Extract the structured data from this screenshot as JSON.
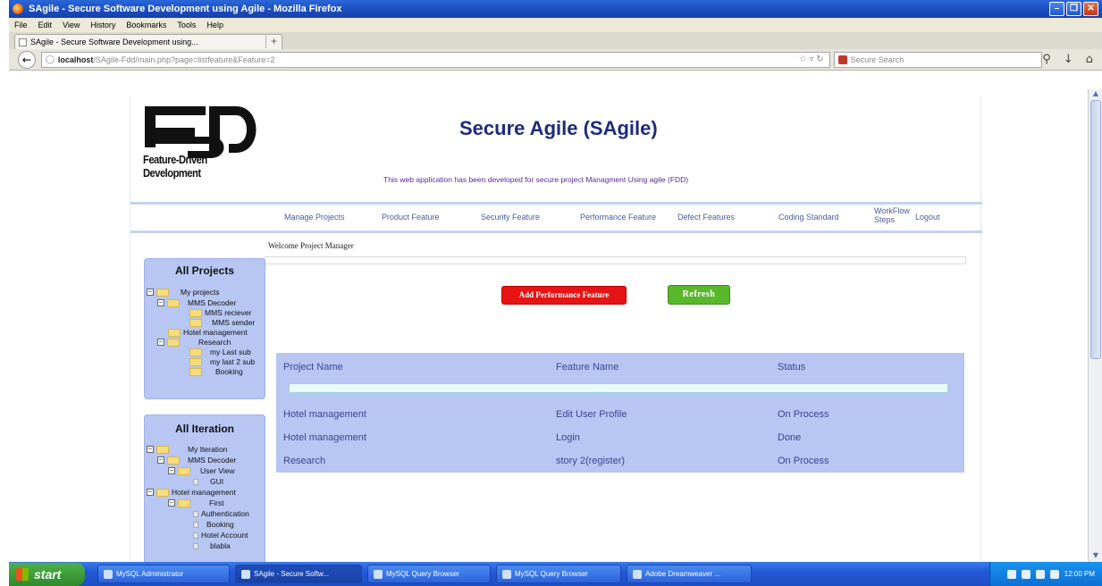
{
  "window": {
    "title": "SAgile - Secure Software Development using Agile - Mozilla Firefox",
    "controls": [
      "minimize-icon",
      "maximize-icon",
      "close-icon"
    ]
  },
  "menubar": [
    "File",
    "Edit",
    "View",
    "History",
    "Bookmarks",
    "Tools",
    "Help"
  ],
  "tab": {
    "label": "SAgile - Secure Software Development using..."
  },
  "address": {
    "host": "localhost",
    "path": "/SAgile-Fdd/main.php?page=listfeature&Feature=2",
    "search_placeholder": "Secure Search"
  },
  "page": {
    "logo_caption": "Feature-Driven Development",
    "title": "Secure Agile (SAgile)",
    "subtitle": "This web application has been developed for secure project Managment Using agile (FDD)",
    "nav": {
      "manage_projects": "Manage Projects",
      "product_feature": "Product Feature",
      "security_feature": "Security Feature",
      "performance_feature": "Performance Feature",
      "defect_features": "Defect Features",
      "coding_standard": "Coding Standard",
      "workflow_line1": "WorkFlow",
      "workflow_line2": "Steps",
      "logout": "Logout"
    },
    "welcome": "Welcome Project Manager",
    "buttons": {
      "add": "Add Performance Feature",
      "refresh": "Refresh"
    },
    "all_projects": {
      "heading": "All Projects",
      "items": [
        "My projects",
        "MMS Decoder",
        "MMS reciever",
        "MMS sender",
        "Hotel management",
        "Research",
        "my Last sub",
        "my last 2 sub",
        "Booking"
      ]
    },
    "all_iteration": {
      "heading": "All Iteration",
      "items": [
        "My Iteration",
        "MMS Decoder",
        "User View",
        "GUI",
        "Hotel management",
        "First",
        "Authentication",
        "Booking",
        "Hotel Account",
        "blabla"
      ]
    },
    "table": {
      "headers": [
        "Project Name",
        "Feature Name",
        "Status"
      ],
      "rows": [
        [
          "Hotel management",
          "Edit User Profile",
          "On Process"
        ],
        [
          "Hotel management",
          "Login",
          "Done"
        ],
        [
          "Research",
          "story 2(register)",
          "On Process"
        ]
      ]
    }
  },
  "taskbar": {
    "start": "start",
    "tasks": [
      "MySQL Administrator",
      "SAgile - Secure Softw...",
      "MySQL Query Browser",
      "MySQL Query Browser",
      "Adobe Dreamweaver ..."
    ],
    "clock": "12:00 PM"
  }
}
